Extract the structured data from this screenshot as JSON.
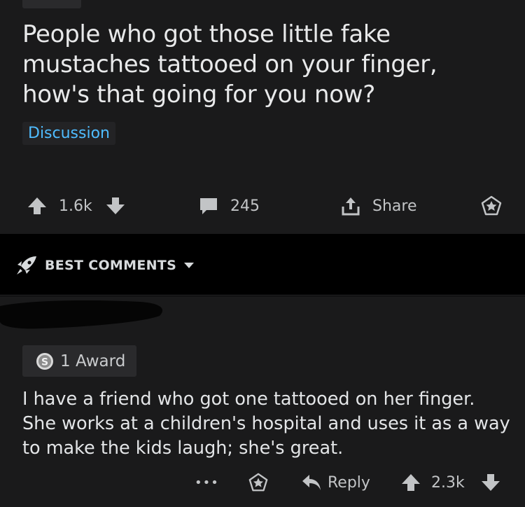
{
  "post": {
    "title": "People who got those little fake mustaches tattooed on your finger, how's that going for you now?",
    "flair": "Discussion",
    "score": "1.6k",
    "comments": "245",
    "share_label": "Share"
  },
  "sort": {
    "label": "BEST COMMENTS"
  },
  "comment": {
    "award_label": "1 Award",
    "body": "I have a friend who got one tattooed on her finger. She works at a children's hospital and uses it as a way to make the kids laugh; she's great.",
    "more": "•••",
    "reply_label": "Reply",
    "score": "2.3k"
  },
  "colors": {
    "background": "#1a1a1b",
    "flair_text": "#4fbcff",
    "text": "#d7dadc"
  },
  "icons": [
    "upvote-icon",
    "downvote-icon",
    "comment-icon",
    "share-icon",
    "award-icon",
    "rocket-icon",
    "chevron-down-icon",
    "silver-award-icon",
    "reply-icon"
  ]
}
